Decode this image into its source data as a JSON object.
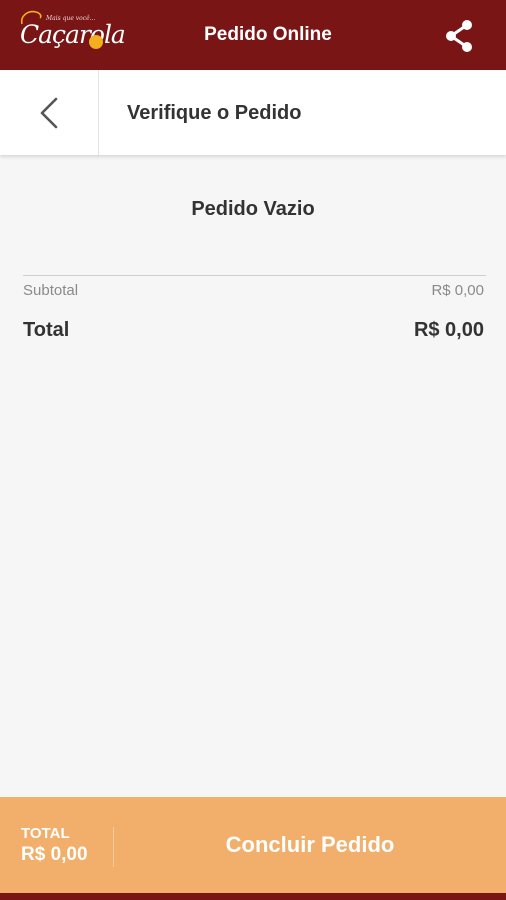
{
  "header": {
    "logo_text": "Caçarola",
    "logo_tagline": "Mais que você...",
    "title": "Pedido Online",
    "share_icon": "share-icon"
  },
  "subheader": {
    "back_icon": "chevron-left-icon",
    "title": "Verifique o Pedido"
  },
  "order": {
    "empty_message": "Pedido Vazio",
    "subtotal_label": "Subtotal",
    "subtotal_value": "R$ 0,00",
    "total_label": "Total",
    "total_value": "R$ 0,00"
  },
  "footer": {
    "total_caption": "TOTAL",
    "total_value": "R$ 0,00",
    "checkout_label": "Concluir Pedido"
  },
  "colors": {
    "brand_dark_red": "#7a1515",
    "accent_orange": "#f2af6b",
    "logo_dot": "#f2b01e",
    "background": "#f6f6f6"
  }
}
